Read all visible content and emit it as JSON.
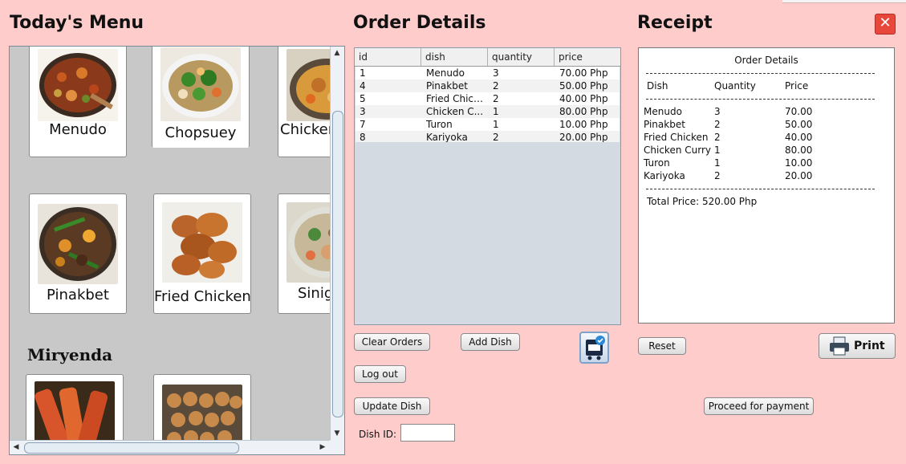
{
  "headings": {
    "menu": "Today's Menu",
    "order": "Order Details",
    "receipt": "Receipt"
  },
  "menu": {
    "items": [
      {
        "name": "Menudo",
        "icon": "menudo-photo"
      },
      {
        "name": "Chopsuey",
        "icon": "chopsuey-photo"
      },
      {
        "name": "Chicken",
        "icon": "chicken-curry-photo"
      },
      {
        "name": "Pinakbet",
        "icon": "pinakbet-photo"
      },
      {
        "name": "Fried Chicken",
        "icon": "fried-chicken-photo"
      },
      {
        "name": "Sinig",
        "icon": "sinigang-photo"
      }
    ],
    "section": "Miryenda",
    "snacks": [
      {
        "icon": "turon-photo"
      },
      {
        "icon": "kwek-kwek-photo"
      }
    ]
  },
  "order_table": {
    "columns": [
      "id",
      "dish",
      "quantity",
      "price"
    ],
    "rows": [
      [
        "1",
        "Menudo",
        "3",
        "70.00 Php"
      ],
      [
        "4",
        "Pinakbet",
        "2",
        "50.00 Php"
      ],
      [
        "5",
        "Fried Chick...",
        "2",
        "40.00 Php"
      ],
      [
        "3",
        "Chicken C...",
        "1",
        "80.00 Php"
      ],
      [
        "7",
        "Turon",
        "1",
        "10.00 Php"
      ],
      [
        "8",
        "Kariyoka",
        "2",
        "20.00 Php"
      ]
    ]
  },
  "buttons": {
    "clear": "Clear Orders",
    "add": "Add Dish",
    "logout": "Log out",
    "update": "Update Dish",
    "reset": "Reset",
    "print": "Print",
    "proceed": "Proceed for payment",
    "cart_icon": "cart-icon",
    "print_icon": "printer-icon"
  },
  "dish_id": {
    "label": "Dish ID:",
    "value": ""
  },
  "receipt": {
    "title": "Order Details",
    "headers": [
      "Dish",
      "Quantity",
      "Price"
    ],
    "rows": [
      [
        "Menudo",
        "3",
        "70.00"
      ],
      [
        "Pinakbet",
        "2",
        "50.00"
      ],
      [
        "Fried Chicken",
        "2",
        "40.00"
      ],
      [
        "Chicken Curry",
        "1",
        "80.00"
      ],
      [
        "Turon",
        "1",
        "10.00"
      ],
      [
        "Kariyoka",
        "2",
        "20.00"
      ]
    ],
    "total": "Total Price: 520.00 Php"
  },
  "window": {
    "close": "✕"
  },
  "colors": {
    "background": "#ffcccc",
    "close": "#e8473c"
  }
}
